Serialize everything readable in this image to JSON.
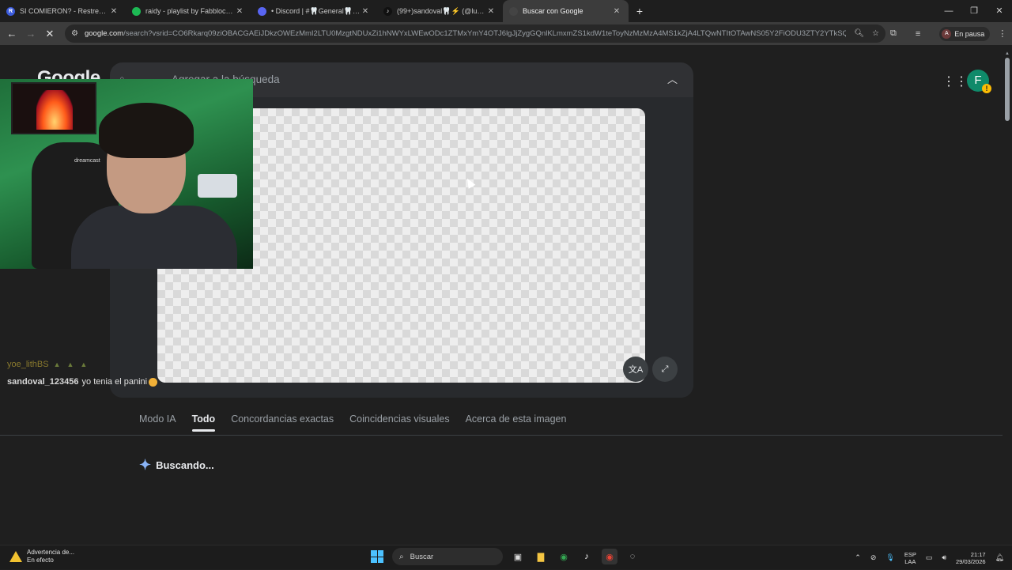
{
  "browser": {
    "tabs": [
      {
        "label": "SI COMIERON? - Restream",
        "favicon_color": "#3b5bdb",
        "favicon_letter": "R",
        "active": false
      },
      {
        "label": "raidy - playlist by Fabblock.Jn |",
        "favicon_color": "#1db954",
        "favicon_letter": "",
        "active": false
      },
      {
        "label": "• Discord | #🦷General🦷 | 🦷",
        "favicon_color": "#5865f2",
        "favicon_letter": "",
        "active": false
      },
      {
        "label": "(99+)sandoval🦷⚡ (@lucas.san",
        "favicon_color": "#111111",
        "favicon_letter": "♪",
        "active": false
      },
      {
        "label": "Buscar con Google",
        "favicon_color": "#444444",
        "favicon_letter": "",
        "active": true
      }
    ],
    "new_tab": "+",
    "window_controls": {
      "minimize": "—",
      "maximize": "❐",
      "close": "✕"
    },
    "nav": {
      "back": "←",
      "forward": "→",
      "reload": "✕"
    },
    "url_host": "google.com",
    "url_rest": "/search?vsrid=CO6Rkarq09ziOBACGAEiJDkzOWEzMmI2LTU0MzgtNDUxZi1hNWYxLWEwODc1ZTMxYmY4OTJ6lgJjZygGQnlKLmxmZS1kdW1teToyNzMzMzA4MS1kZjA4LTQwNTItOTAwNS05Y2FiODU3ZTY2YTkSQAo-L2Jucy9j...",
    "pause_label": "En pausa",
    "pause_avatar": "A"
  },
  "google": {
    "logo": "Google",
    "search_placeholder": "Agregar a la búsqueda",
    "account_initial": "F",
    "account_warning": "!",
    "filters": [
      {
        "label": "Modo IA",
        "active": false
      },
      {
        "label": "Todo",
        "active": true
      },
      {
        "label": "Concordancias exactas",
        "active": false
      },
      {
        "label": "Coincidencias visuales",
        "active": false
      },
      {
        "label": "Acerca de esta imagen",
        "active": false
      }
    ],
    "status": "Buscando...",
    "translate_icon": "文A",
    "expand_icon": "⤢"
  },
  "overlay": {
    "chair_text": "dreamcast",
    "chat": [
      {
        "user": "yoe_lithBS",
        "message": "",
        "badges": "▲▲▲"
      },
      {
        "user": "sandoval_123456",
        "message": "yo tenia el panini",
        "badges": ""
      }
    ]
  },
  "taskbar": {
    "warning_title": "Advertencia de...",
    "warning_sub": "En efecto",
    "search_label": "Buscar",
    "lang_top": "ESP",
    "lang_bottom": "LAA",
    "time": "21:17",
    "date": "29/03/2026"
  }
}
